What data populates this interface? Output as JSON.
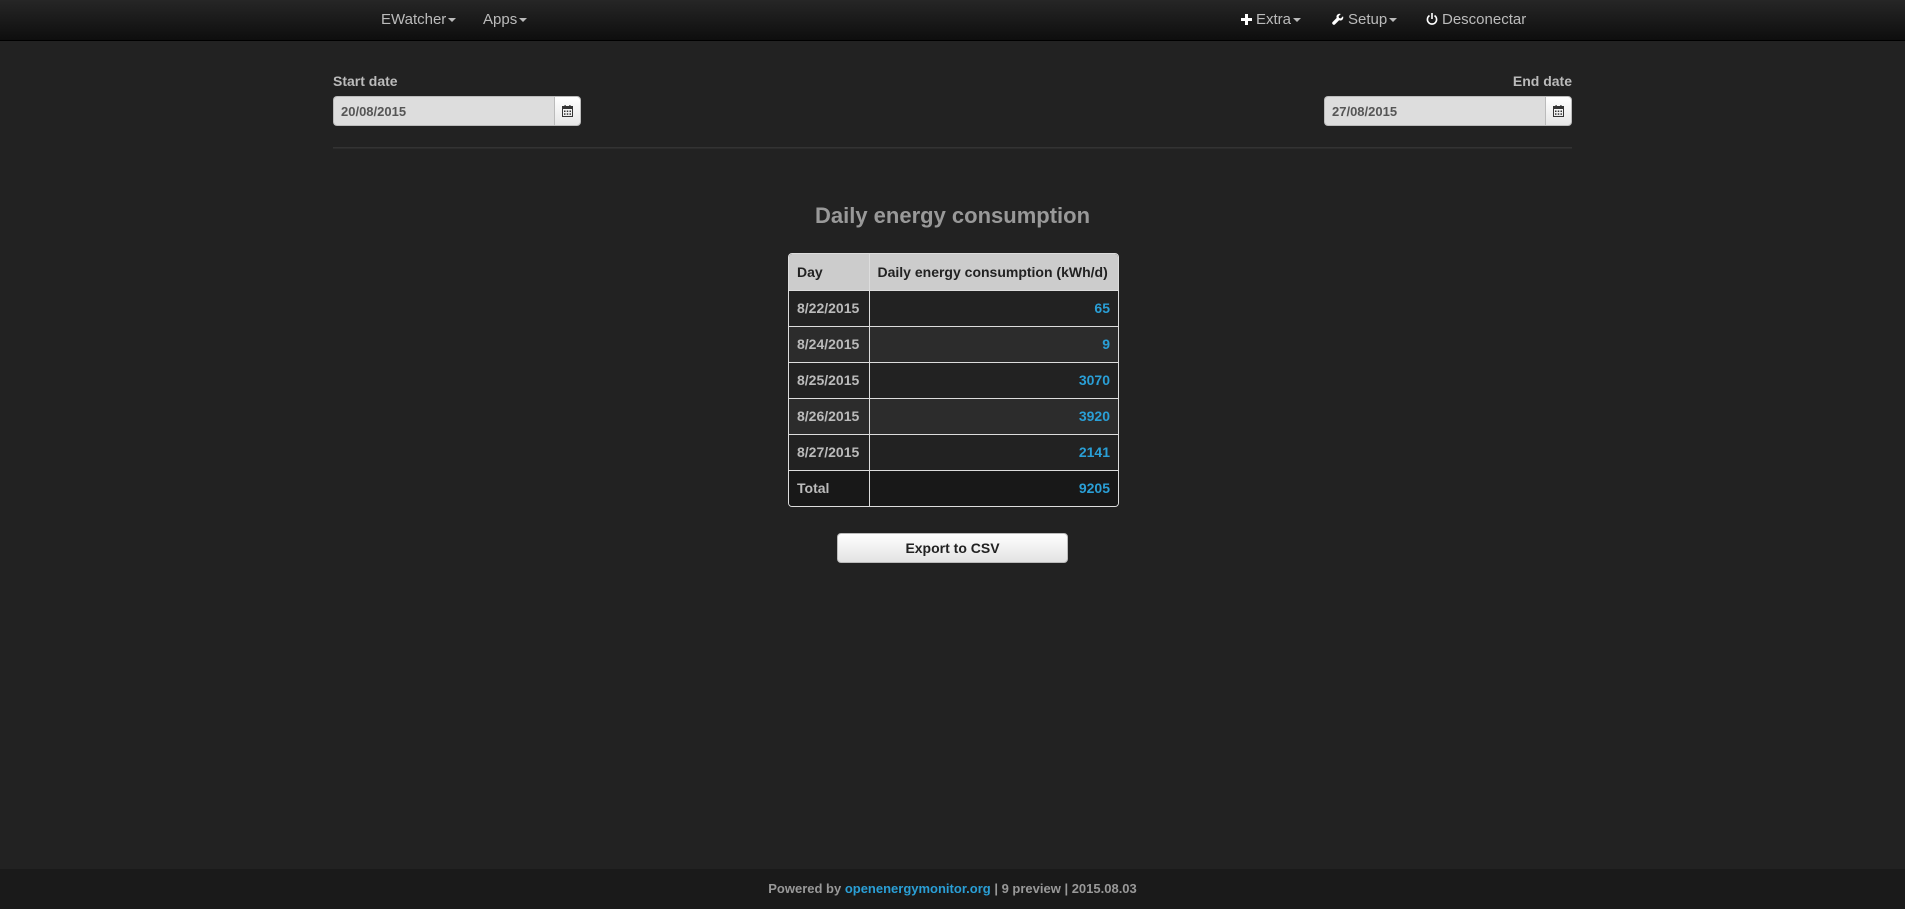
{
  "navbar": {
    "left_items": [
      {
        "label": "EWatcher"
      },
      {
        "label": "Apps"
      }
    ],
    "right_items": [
      {
        "label": "Extra",
        "icon": "plus-icon"
      },
      {
        "label": "Setup",
        "icon": "wrench-icon"
      },
      {
        "label": "Desconectar",
        "icon": "power-icon"
      }
    ]
  },
  "filters": {
    "start_label": "Start date",
    "start_value": "20/08/2015",
    "end_label": "End date",
    "end_value": "27/08/2015",
    "calendar_icon": "calendar-icon"
  },
  "main": {
    "title": "Daily energy consumption",
    "table": {
      "headers": [
        "Day",
        "Daily energy consumption (kWh/d)"
      ],
      "rows": [
        [
          "8/22/2015",
          "65"
        ],
        [
          "8/24/2015",
          "9"
        ],
        [
          "8/25/2015",
          "3070"
        ],
        [
          "8/26/2015",
          "3920"
        ],
        [
          "8/27/2015",
          "2141"
        ]
      ],
      "total_label": "Total",
      "total_value": "9205"
    },
    "export_label": "Export to CSV"
  },
  "footer": {
    "prefix": "Powered by ",
    "link_text": "openenergymonitor.org",
    "suffix": " | 9 preview | 2015.08.03"
  },
  "colors": {
    "background": "#222222",
    "accent": "#2a9fd6",
    "navbar": "#1b1b1b"
  }
}
